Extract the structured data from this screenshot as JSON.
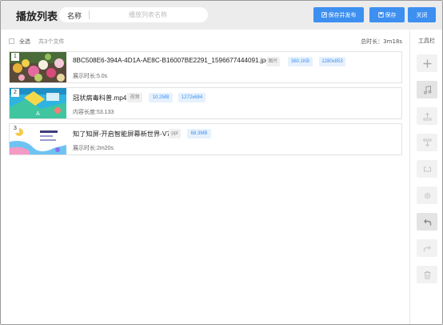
{
  "header": {
    "title": "播放列表",
    "name_label": "名称",
    "name_placeholder": "播放列表名称",
    "buttons": {
      "save_publish": "保存并发布",
      "save": "保存",
      "close": "关闭"
    }
  },
  "list": {
    "select_all": "全选",
    "file_count": "共3个文件",
    "total_duration": "总时长：3m18s",
    "items": [
      {
        "index": "1",
        "name": "8BC508E6-394A-4D1A-AE8C-B16007BE2291_1596677444091.jpeg",
        "type_tag": "图片",
        "size": "360.1KB",
        "resolution": "1280x853",
        "meta": "展示时长:5.0s"
      },
      {
        "index": "2",
        "name": "冠状病毒科普.mp4",
        "type_tag": "视频",
        "size": "10.2MB",
        "resolution": "1272x684",
        "meta": "内容长度:53.133"
      },
      {
        "index": "3",
        "name": "知了知屏-开启智能屏幕新世界-V7",
        "type_tag": "ppt",
        "size": "68.3MB",
        "meta": "展示时长:2m20s"
      }
    ]
  },
  "toolbar": {
    "title": "工具栏",
    "tools": [
      "add-icon",
      "music-icon",
      "move-top-icon",
      "move-bottom-icon",
      "loop-icon",
      "settings-icon",
      "undo-icon",
      "redo-icon",
      "delete-icon"
    ]
  },
  "colors": {
    "accent": "#3d8ff0",
    "header_bg": "#ececec",
    "tag_info_bg": "#e6f1fd"
  }
}
